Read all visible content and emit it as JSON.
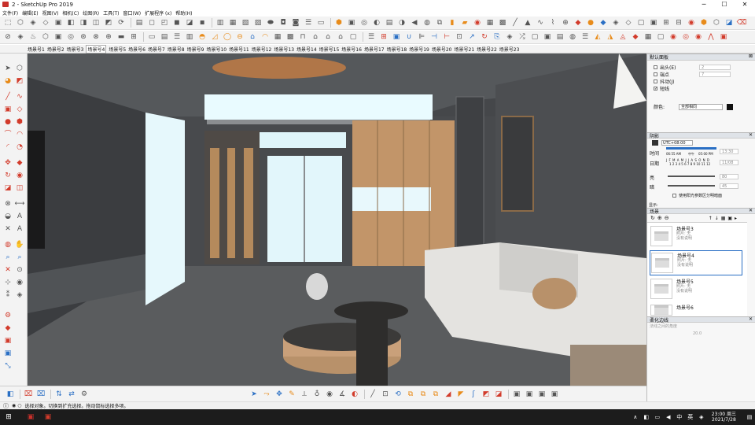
{
  "window": {
    "title": "2 - SketchUp Pro 2019",
    "min": "─",
    "max": "☐",
    "close": "✕"
  },
  "menu": [
    "文件(F)",
    "编辑(E)",
    "视图(V)",
    "相机(C)",
    "绘图(R)",
    "工具(T)",
    "窗口(W)",
    "扩展程序 (x)",
    "帮助(H)"
  ],
  "scene_tabs": [
    "场景号1",
    "场景号2",
    "场景号3",
    "场景号4",
    "场景号5",
    "场景号6",
    "场景号7",
    "场景号8",
    "场景号9",
    "场景号10",
    "场景号11",
    "场景号12",
    "场景号13",
    "场景号14",
    "场景号15",
    "场景号16",
    "场景号17",
    "场景号18",
    "场景号19",
    "场景号20",
    "场景号21",
    "场景号22",
    "场景号23"
  ],
  "active_scene_tab": "场景号4",
  "panel": {
    "tray_title": "默认面板",
    "styles_rows": [
      {
        "label": "出头(E)",
        "value": "2",
        "checked": false
      },
      {
        "label": "端点",
        "value": "7",
        "checked": false
      },
      {
        "label": "抖动(J)",
        "value": "",
        "checked": false
      },
      {
        "label": "短线",
        "value": "",
        "checked": true
      }
    ],
    "color_label": "颜色:",
    "color_value": "全部相同",
    "shadow_header": "阴影",
    "shadow_tz": "UTC+08:00",
    "time_label": "时间",
    "time_start": "06:55 AM",
    "time_mid": "中午",
    "time_end": "05:00 PM",
    "time_value": "13:30",
    "date_label": "日期",
    "date_months": "J F M A M J J A S O N D",
    "date_value": "11/08",
    "months_numbers": "1 2 3 4 5 6 7 8 9 10 11 12",
    "light_label": "亮",
    "light_value": "80",
    "dark_label": "暗",
    "dark_value": "45",
    "sun_option": "使用阳光参数区分明暗面",
    "display_label": "显示:",
    "scenes_header": "场景",
    "scenes": [
      {
        "name": "场景号3",
        "desc1": "照片: 无",
        "desc2": "没有说明"
      },
      {
        "name": "场景号4",
        "desc1": "照片: 无",
        "desc2": "没有说明"
      },
      {
        "name": "场景号5",
        "desc1": "照片: 无",
        "desc2": "没有说明"
      },
      {
        "name": "场景号6",
        "desc1": "",
        "desc2": ""
      }
    ],
    "soften_header": "柔化边线",
    "soften_hint": "法线之间的角度",
    "soften_value": "20.0"
  },
  "status": {
    "text": "选择对象。切换到扩充选择。拖动鼠标选择多项。"
  },
  "taskbar": {
    "time": "23:00 周三",
    "date": "2021/7/28",
    "ime1": "中",
    "ime2": "英"
  },
  "colors": {
    "accent": "#d23b2b",
    "selected_scene": "#2a6fc4"
  }
}
